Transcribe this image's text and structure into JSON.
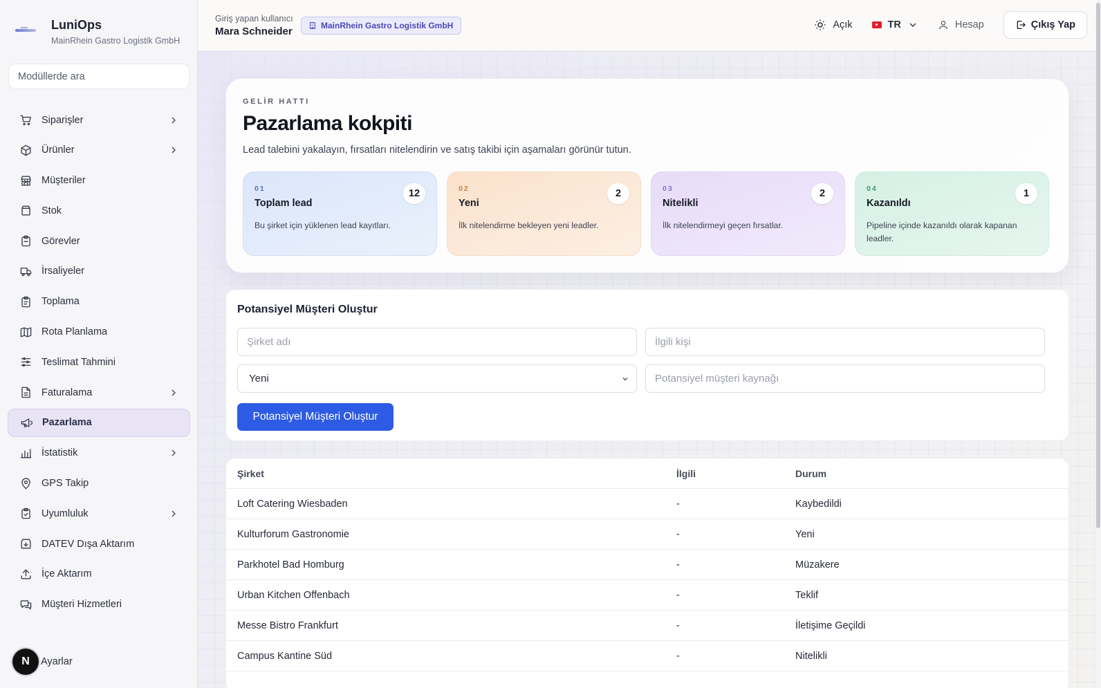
{
  "brand": {
    "name": "LuniOps",
    "company": "MainRhein Gastro Logistik GmbH"
  },
  "sidebar": {
    "search_placeholder": "Modüllerde ara",
    "items": [
      {
        "label": "Siparişler",
        "icon": "cart-icon",
        "chevron": true
      },
      {
        "label": "Ürünler",
        "icon": "box-icon",
        "chevron": true
      },
      {
        "label": "Müşteriler",
        "icon": "store-icon",
        "chevron": false
      },
      {
        "label": "Stok",
        "icon": "archive-icon",
        "chevron": false
      },
      {
        "label": "Görevler",
        "icon": "clipboard-icon",
        "chevron": false
      },
      {
        "label": "İrsaliyeler",
        "icon": "truck-icon",
        "chevron": false
      },
      {
        "label": "Toplama",
        "icon": "clipboard-list-icon",
        "chevron": false
      },
      {
        "label": "Rota Planlama",
        "icon": "map-icon",
        "chevron": false
      },
      {
        "label": "Teslimat Tahmini",
        "icon": "sliders-icon",
        "chevron": false
      },
      {
        "label": "Faturalama",
        "icon": "file-icon",
        "chevron": true
      },
      {
        "label": "Pazarlama",
        "icon": "megaphone-icon",
        "chevron": false,
        "active": true
      },
      {
        "label": "İstatistik",
        "icon": "bar-chart-icon",
        "chevron": true
      },
      {
        "label": "GPS Takip",
        "icon": "map-pin-icon",
        "chevron": false
      },
      {
        "label": "Uyumluluk",
        "icon": "clipboard-check-icon",
        "chevron": true
      },
      {
        "label": "DATEV Dışa Aktarım",
        "icon": "download-icon",
        "chevron": false
      },
      {
        "label": "İçe Aktarım",
        "icon": "upload-icon",
        "chevron": false
      },
      {
        "label": "Müşteri Hizmetleri",
        "icon": "chat-icon",
        "chevron": false
      }
    ],
    "settings_label": "Ayarlar",
    "avatar_letter": "N"
  },
  "topbar": {
    "user_caption": "Giriş yapan kullanıcı",
    "user_name": "Mara Schneider",
    "company_badge": "MainRhein Gastro Logistik GmbH",
    "theme_label": "Açık",
    "language": "TR",
    "account_label": "Hesap",
    "logout_label": "Çıkış Yap"
  },
  "hero": {
    "eyebrow": "GELİR HATTI",
    "title": "Pazarlama kokpiti",
    "description": "Lead talebini yakalayın, fırsatları nitelendirin ve satış takibi için aşamaları görünür tutun.",
    "kpis": [
      {
        "num": "01",
        "title": "Toplam lead",
        "count": "12",
        "desc": "Bu şirket için yüklenen lead kayıtları."
      },
      {
        "num": "02",
        "title": "Yeni",
        "count": "2",
        "desc": "İlk nitelendirme bekleyen yeni leadler."
      },
      {
        "num": "03",
        "title": "Nitelikli",
        "count": "2",
        "desc": "İlk nitelendirmeyi geçen fırsatlar."
      },
      {
        "num": "04",
        "title": "Kazanıldı",
        "count": "1",
        "desc": "Pipeline içinde kazanıldı olarak kapanan leadler."
      }
    ]
  },
  "form": {
    "title": "Potansiyel Müşteri Oluştur",
    "company_placeholder": "Şirket adı",
    "contact_placeholder": "İlgili kişi",
    "status_value": "Yeni",
    "source_placeholder": "Potansiyel müşteri kaynağı",
    "submit_label": "Potansiyel Müşteri Oluştur"
  },
  "table": {
    "headers": [
      "Şirket",
      "İlgili",
      "Durum"
    ],
    "rows": [
      [
        "Loft Catering Wiesbaden",
        "-",
        "Kaybedildi"
      ],
      [
        "Kulturforum Gastronomie",
        "-",
        "Yeni"
      ],
      [
        "Parkhotel Bad Homburg",
        "-",
        "Müzakere"
      ],
      [
        "Urban Kitchen Offenbach",
        "-",
        "Teklif"
      ],
      [
        "Messe Bistro Frankfurt",
        "-",
        "İletişime Geçildi"
      ],
      [
        "Campus Kantine Süd",
        "-",
        "Nitelikli"
      ]
    ]
  },
  "colors": {
    "accent": "#2d5be3",
    "active_nav": "#e8e4f6"
  }
}
